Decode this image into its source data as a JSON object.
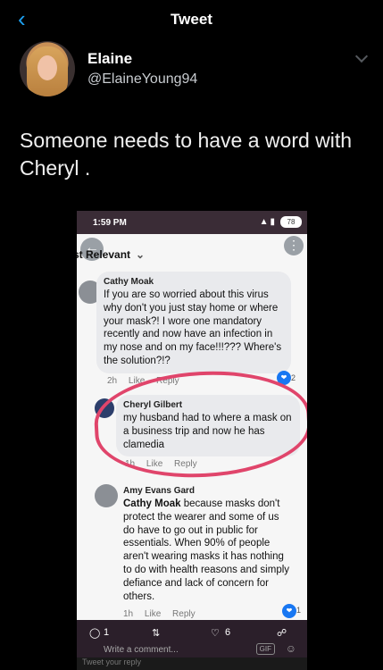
{
  "header": {
    "title": "Tweet"
  },
  "author": {
    "name": "Elaine",
    "handle": "@ElaineYoung94"
  },
  "tweet": {
    "text": "Someone needs to have a word with Cheryl ."
  },
  "screenshot": {
    "status": {
      "time": "1:59 PM",
      "battery": "78"
    },
    "sort_label": "st Relevant",
    "comments": [
      {
        "name": "Cathy Moak",
        "text": "If you are so worried about this virus why don't you just stay home or where your mask?! I wore one mandatory recently and now have an infection in my nose and on my face!!!??? Where's the solution?!?",
        "time": "2h",
        "like": "Like",
        "reply": "Reply",
        "reactions": "2"
      },
      {
        "name": "Cheryl Gilbert",
        "text": "my husband had to where a mask on a business trip and now he has clamedia",
        "time": "1h",
        "like": "Like",
        "reply": "Reply"
      },
      {
        "name": "Amy Evans Gard",
        "mention": "Cathy Moak",
        "text": "because masks don't protect the wearer and some of us do have to go out in public for essentials. When 90% of people aren't wearing masks it has nothing to do with health reasons and simply defiance and lack of concern for others.",
        "time": "1h",
        "like": "Like",
        "reply": "Reply",
        "reactions": "1"
      }
    ],
    "actions": {
      "replies": "1",
      "likes": "6"
    },
    "compose_placeholder": "Write a comment...",
    "gif_label": "GIF",
    "reply_placeholder": "Tweet your reply"
  },
  "colors": {
    "accent": "#1da1f2",
    "highlight": "#e0456b"
  }
}
